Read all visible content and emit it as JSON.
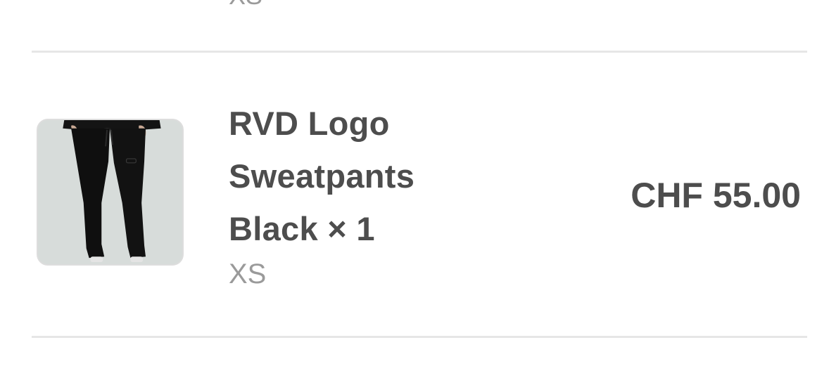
{
  "cart": {
    "previous_item": {
      "variant": "XS"
    },
    "item": {
      "image_alt": "black-sweatpants-product-photo",
      "name": "RVD Logo Sweatpants Black",
      "qty_separator": "×",
      "quantity": "1",
      "variant": "XS",
      "price": "CHF 55.00"
    }
  },
  "colors": {
    "text_primary": "#4d4d4d",
    "text_secondary": "#9a9a9a",
    "divider": "#e6e6e6"
  }
}
